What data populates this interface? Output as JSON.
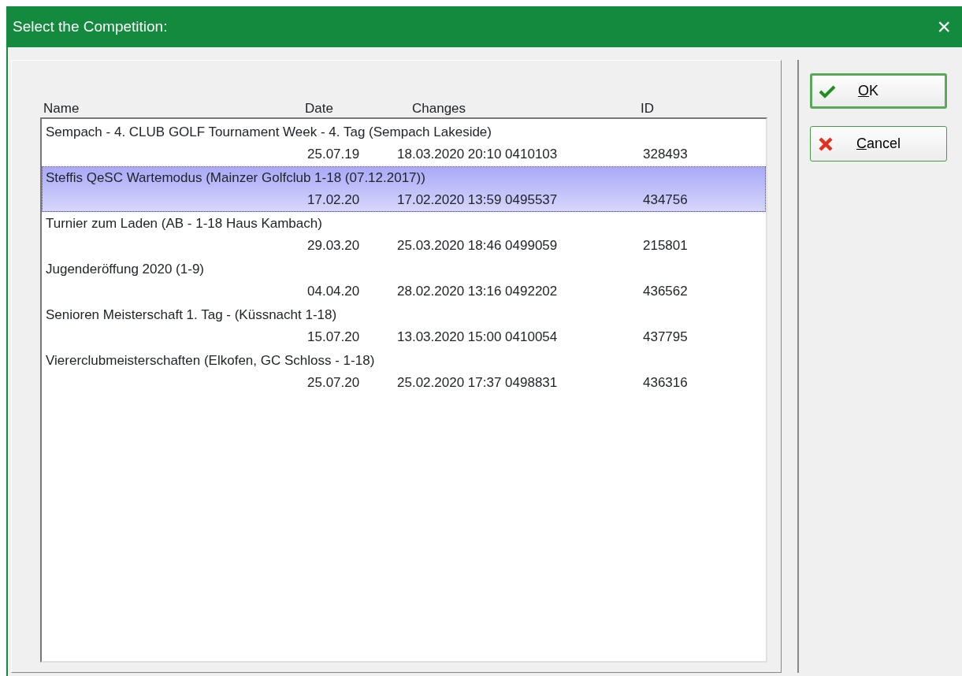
{
  "window": {
    "title": "Select the Competition:",
    "close": "×"
  },
  "list": {
    "columns": [
      "Name",
      "Date",
      "Changes",
      "ID"
    ],
    "rows": [
      {
        "name": "Sempach - 4. CLUB GOLF Tournament Week - 4. Tag (Sempach Lakeside)",
        "date": "25.07.19",
        "changes": "18.03.2020 20:10 0410103",
        "id": "328493",
        "selected": false
      },
      {
        "name": "Steffis QeSC Wartemodus (Mainzer Golfclub 1-18 (07.12.2017))",
        "date": "17.02.20",
        "changes": "17.02.2020 13:59 0495537",
        "id": "434756",
        "selected": true
      },
      {
        "name": "Turnier zum Laden (AB - 1-18 Haus Kambach)",
        "date": "29.03.20",
        "changes": "25.03.2020 18:46 0499059",
        "id": "215801",
        "selected": false
      },
      {
        "name": "Jugenderöffung 2020 (1-9)",
        "date": "04.04.20",
        "changes": "28.02.2020 13:16 0492202",
        "id": "436562",
        "selected": false
      },
      {
        "name": "Senioren Meisterschaft 1. Tag - (Küssnacht 1-18)",
        "date": "15.07.20",
        "changes": "13.03.2020 15:00 0410054",
        "id": "437795",
        "selected": false
      },
      {
        "name": "Viererclubmeisterschaften (Elkofen, GC Schloss - 1-18)",
        "date": "25.07.20",
        "changes": "25.02.2020 17:37 0498831",
        "id": "436316",
        "selected": false
      }
    ]
  },
  "buttons": [
    {
      "kind": "ok",
      "label": "OK",
      "mnemonic_underlined": true,
      "default": true
    },
    {
      "kind": "cancel",
      "label": "Cancel",
      "mnemonic_underlined": true,
      "default": false
    }
  ]
}
